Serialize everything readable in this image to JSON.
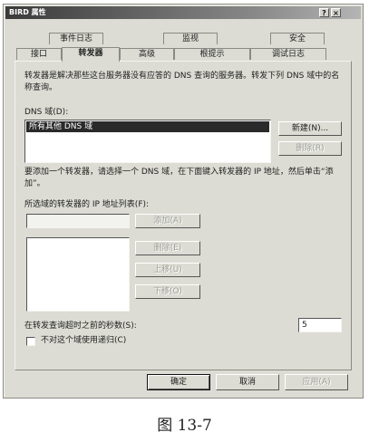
{
  "window": {
    "title": "BIRD 属性",
    "title_buttons": [
      "?",
      "×"
    ]
  },
  "tabs_back": [
    "事件日志",
    "监视",
    "安全"
  ],
  "tabs_front": [
    "接口",
    "转发器",
    "高级",
    "根提示",
    "调试日志"
  ],
  "active_tab": "转发器",
  "description": "转发器是解决那些这台服务器没有应答的 DNS 查询的服务器。转发下列 DNS 域中的名称查询。",
  "dns_domain": {
    "label": "DNS 域(D):",
    "items": [
      "所有其他 DNS 域"
    ],
    "new_button": "新建(N)...",
    "delete_button": "删除(R)"
  },
  "hint": "要添加一个转发器，请选择一个 DNS 域，在下面键入转发器的 IP 地址，然后单击“添加”。",
  "forwarder_ip": {
    "label": "所选域的转发器的 IP 地址列表(F):",
    "input_value": "",
    "add_button": "添加(A)",
    "delete_button": "删除(E)",
    "up_button": "上移(U)",
    "down_button": "下移(O)"
  },
  "timeout": {
    "label": "在转发查询超时之前的秒数(S):",
    "value": "5"
  },
  "recursion_checkbox": {
    "label": "不对这个域使用递归(C)",
    "checked": false
  },
  "footer": {
    "ok": "确定",
    "cancel": "取消",
    "apply": "应用(A)"
  },
  "caption": "图 13-7"
}
